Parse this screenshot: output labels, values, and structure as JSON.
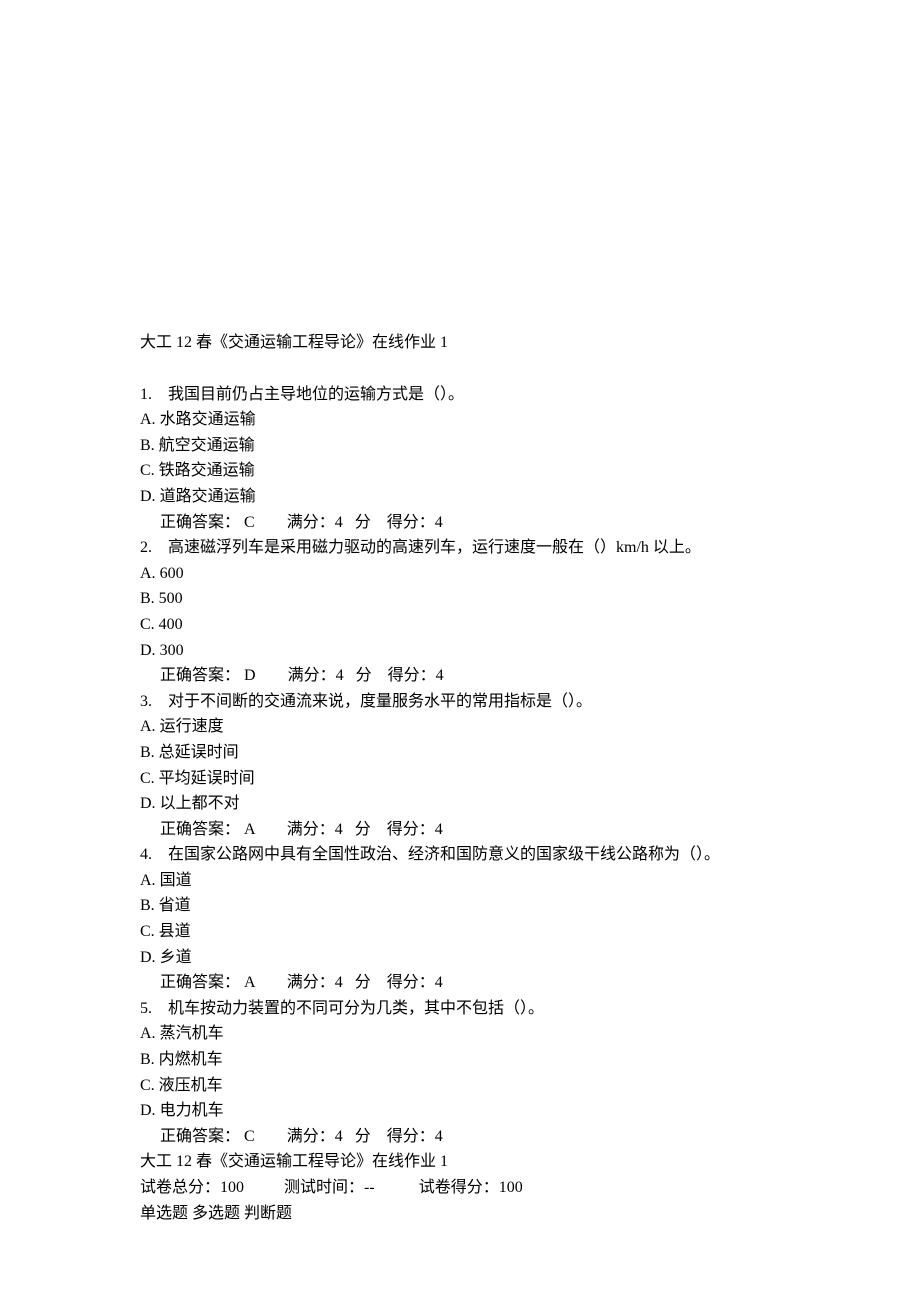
{
  "title": "大工 12 春《交通运输工程导论》在线作业 1",
  "questions": [
    {
      "num": "1.",
      "stem": "我国目前仍占主导地位的运输方式是（）。",
      "options": [
        {
          "label": "A.",
          "text": "水路交通运输"
        },
        {
          "label": "B.",
          "text": "航空交通运输"
        },
        {
          "label": "C.",
          "text": "铁路交通运输"
        },
        {
          "label": "D.",
          "text": "道路交通运输"
        }
      ],
      "answer_label": "正确答案：",
      "answer_value": "C",
      "full_score_label": "满分：",
      "full_score_value": "4",
      "unit": "分",
      "gain_label": "得分：",
      "gain_value": "4"
    },
    {
      "num": "2.",
      "stem": "高速磁浮列车是采用磁力驱动的高速列车，运行速度一般在（）km/h 以上。",
      "options": [
        {
          "label": "A.",
          "text": "600"
        },
        {
          "label": "B.",
          "text": "500"
        },
        {
          "label": "C.",
          "text": "400"
        },
        {
          "label": "D.",
          "text": "300"
        }
      ],
      "answer_label": "正确答案：",
      "answer_value": "D",
      "full_score_label": "满分：",
      "full_score_value": "4",
      "unit": "分",
      "gain_label": "得分：",
      "gain_value": "4"
    },
    {
      "num": "3.",
      "stem": "对于不间断的交通流来说，度量服务水平的常用指标是（）。",
      "options": [
        {
          "label": "A.",
          "text": "运行速度"
        },
        {
          "label": "B.",
          "text": "总延误时间"
        },
        {
          "label": "C.",
          "text": "平均延误时间"
        },
        {
          "label": "D.",
          "text": "以上都不对"
        }
      ],
      "answer_label": "正确答案：",
      "answer_value": "A",
      "full_score_label": "满分：",
      "full_score_value": "4",
      "unit": "分",
      "gain_label": "得分：",
      "gain_value": "4"
    },
    {
      "num": "4.",
      "stem": "在国家公路网中具有全国性政治、经济和国防意义的国家级干线公路称为（）。",
      "options": [
        {
          "label": "A.",
          "text": "国道"
        },
        {
          "label": "B.",
          "text": "省道"
        },
        {
          "label": "C.",
          "text": "县道"
        },
        {
          "label": "D.",
          "text": "乡道"
        }
      ],
      "answer_label": "正确答案：",
      "answer_value": "A",
      "full_score_label": "满分：",
      "full_score_value": "4",
      "unit": "分",
      "gain_label": "得分：",
      "gain_value": "4"
    },
    {
      "num": "5.",
      "stem": "机车按动力装置的不同可分为几类，其中不包括（）。",
      "options": [
        {
          "label": "A.",
          "text": "蒸汽机车"
        },
        {
          "label": "B.",
          "text": "内燃机车"
        },
        {
          "label": "C.",
          "text": "液压机车"
        },
        {
          "label": "D.",
          "text": "电力机车"
        }
      ],
      "answer_label": "正确答案：",
      "answer_value": "C",
      "full_score_label": "满分：",
      "full_score_value": "4",
      "unit": "分",
      "gain_label": "得分：",
      "gain_value": "4"
    }
  ],
  "footer_title": "大工 12 春《交通运输工程导论》在线作业 1",
  "totals": {
    "total_score_label": "试卷总分：",
    "total_score_value": "100",
    "test_time_label": "测试时间：",
    "test_time_value": "--",
    "gain_score_label": "试卷得分：",
    "gain_score_value": "100"
  },
  "question_types": {
    "single": "单选题",
    "multi": "多选题",
    "judge": "判断题"
  }
}
